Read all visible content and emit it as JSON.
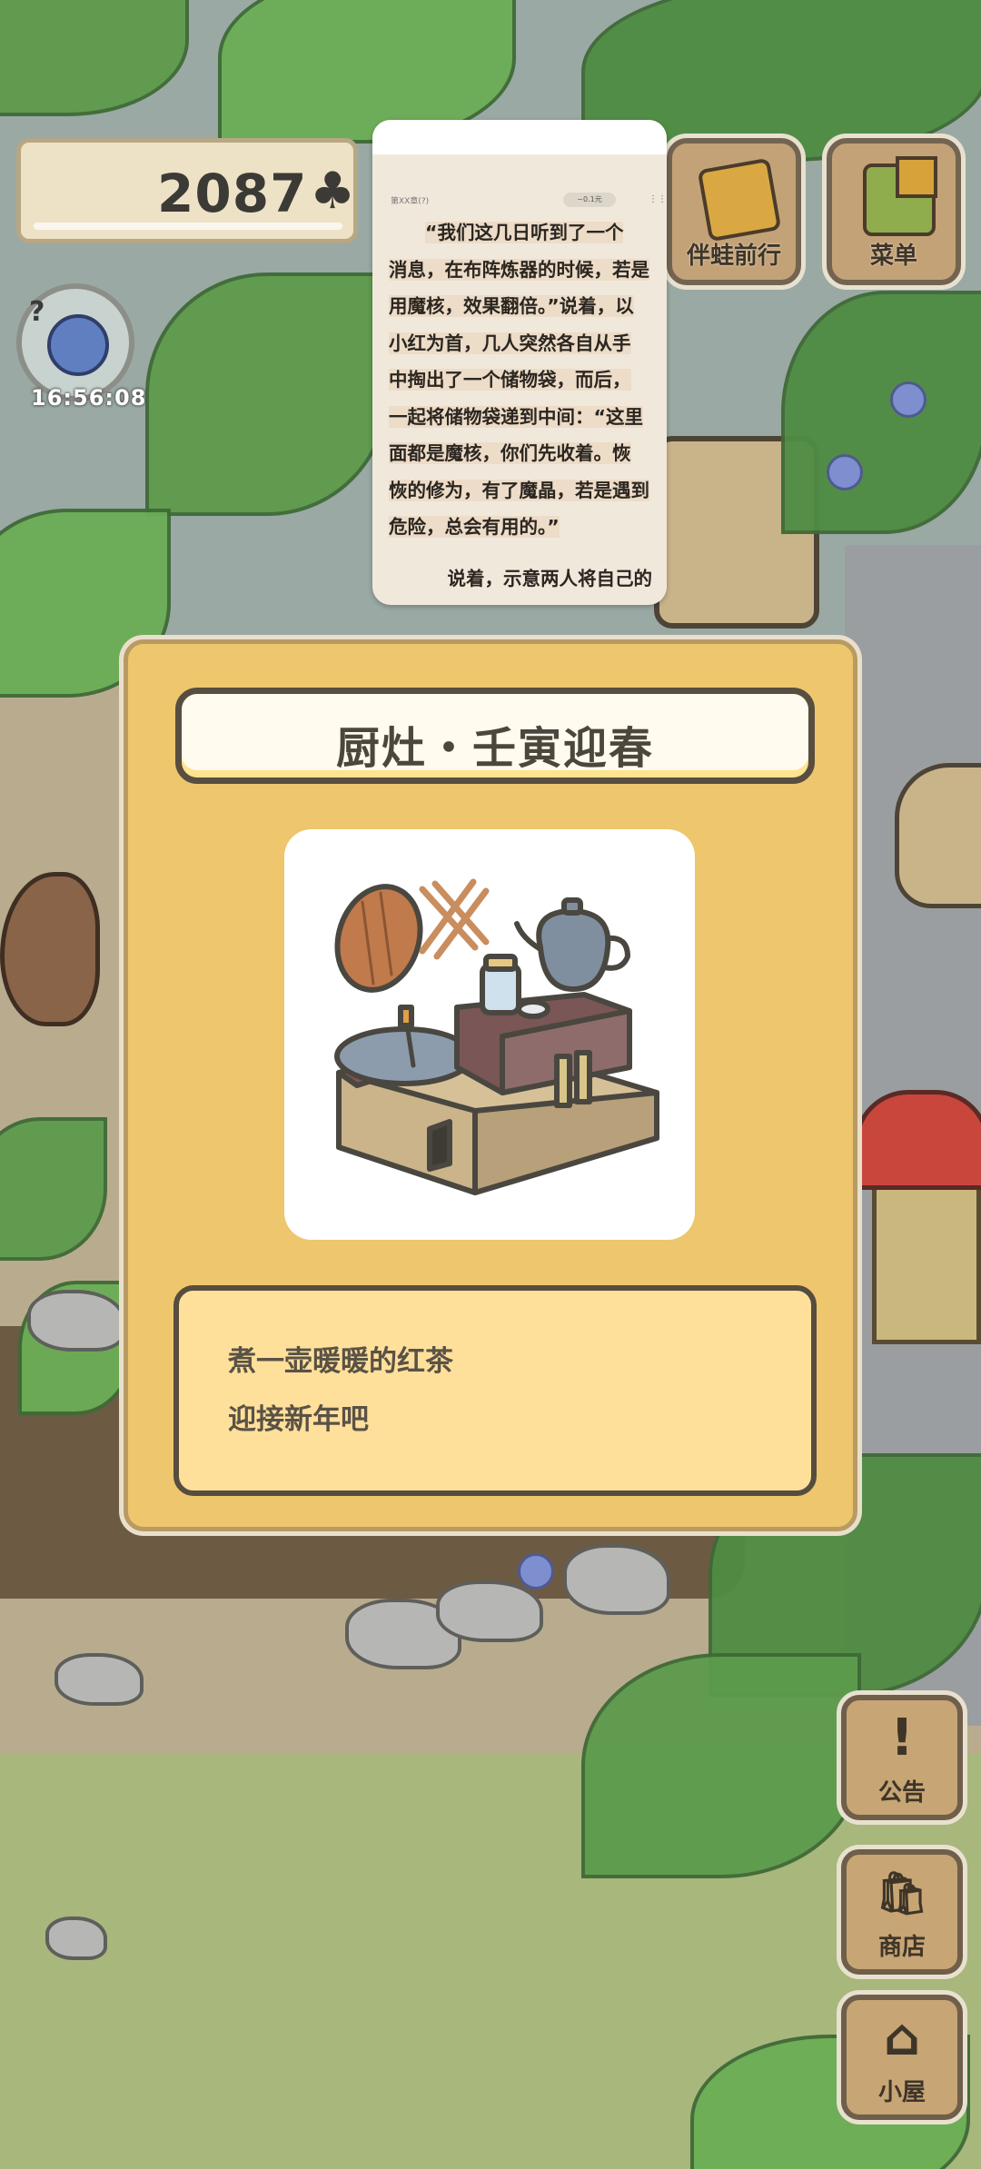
{
  "hud": {
    "clover_count": "2087",
    "clover_symbol": "♣",
    "clock": "16:56:08",
    "avatar_marks": "?"
  },
  "top_buttons": [
    {
      "label": "伴蛙前行",
      "icon": "travel-book-icon"
    },
    {
      "label": "菜单",
      "icon": "menu-tiles-icon"
    }
  ],
  "side_buttons": [
    {
      "label": "公告",
      "icon": "exclamation-icon",
      "glyph": "!"
    },
    {
      "label": "商店",
      "icon": "shop-bags-icon",
      "glyph": "🛍"
    },
    {
      "label": "小屋",
      "icon": "house-icon",
      "glyph": "⌂"
    }
  ],
  "reader": {
    "chapter": "第XX章(?)",
    "pill": "~0.1元",
    "menu_glyph": "⋮⋮",
    "paragraph": [
      "“我们这几日听到了一个",
      "消息，在布阵炼器的时候，若是",
      "用魔核，效果翻倍。”说着，以",
      "小红为首，几人突然各自从手",
      "中掏出了一个储物袋，而后，",
      "一起将储物袋递到中间：“这里",
      "面都是魔核，你们先收着。恢",
      "恢的修为，有了魔晶，若是遇到",
      "危险，总会有用的。”"
    ],
    "last_line": "说着，示意两人将自己的"
  },
  "item_card": {
    "title": "厨灶・壬寅迎春",
    "description_lines": [
      "煮一壶暖暖的红茶",
      "迎接新年吧"
    ],
    "colors": {
      "card": "#eec66d",
      "desc": "#ffe09b",
      "outline": "#574e40"
    }
  }
}
